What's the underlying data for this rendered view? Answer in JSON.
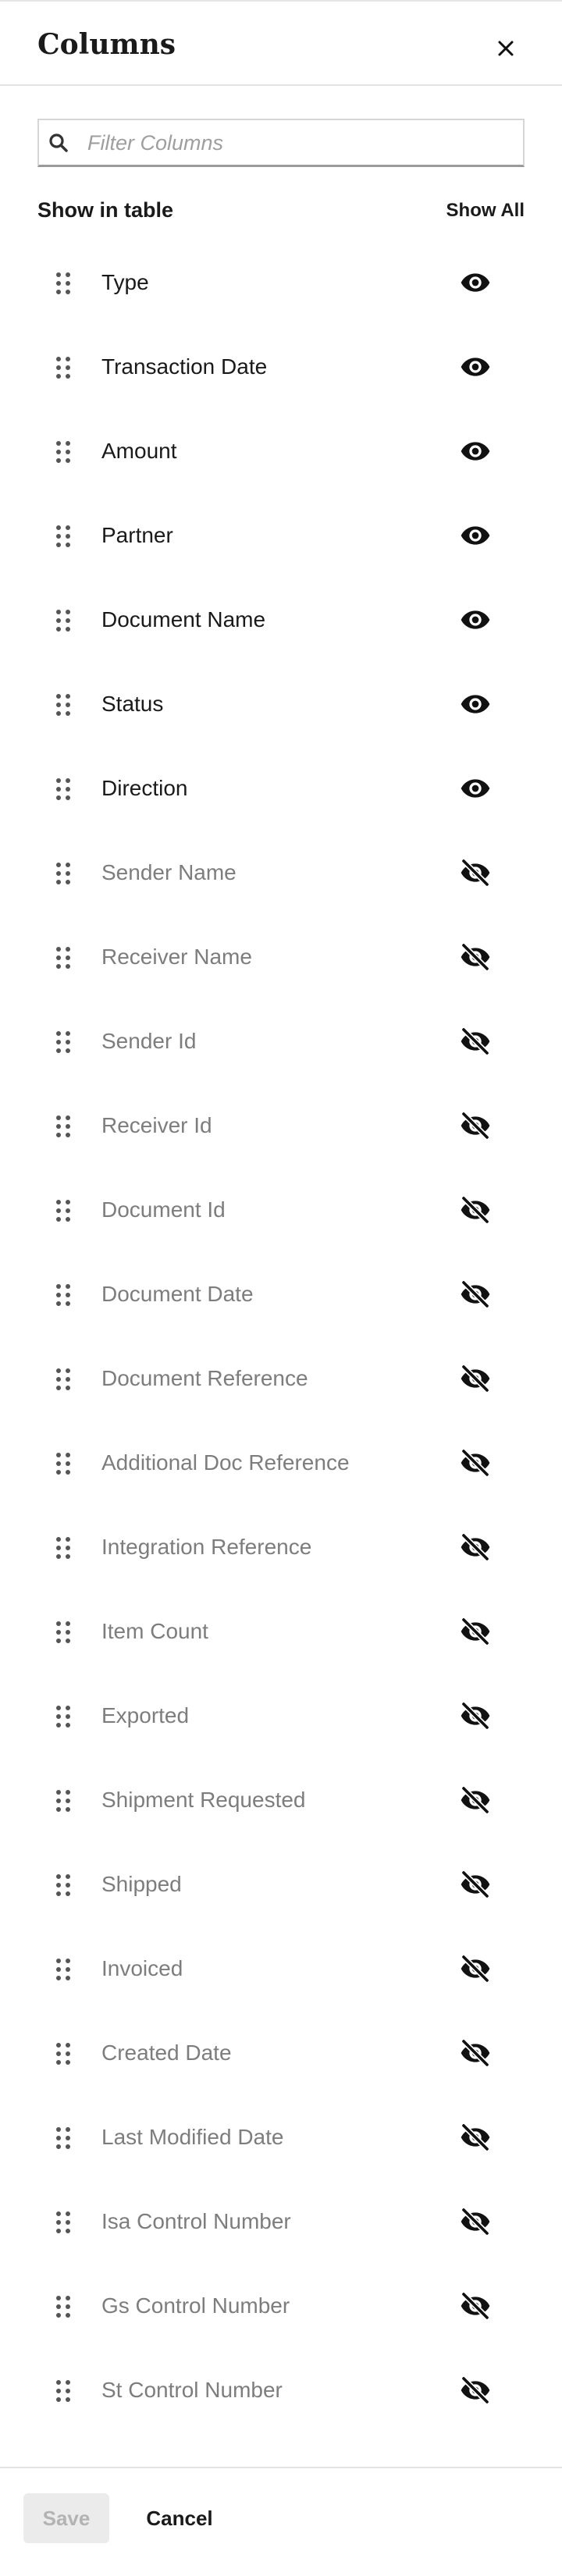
{
  "header": {
    "title": "Columns",
    "close_icon": "close-icon"
  },
  "search": {
    "placeholder": "Filter Columns",
    "value": "",
    "icon": "search-icon"
  },
  "section": {
    "title": "Show in table",
    "show_all_label": "Show All"
  },
  "columns": [
    {
      "label": "Type",
      "visible": true
    },
    {
      "label": "Transaction Date",
      "visible": true
    },
    {
      "label": "Amount",
      "visible": true
    },
    {
      "label": "Partner",
      "visible": true
    },
    {
      "label": "Document Name",
      "visible": true
    },
    {
      "label": "Status",
      "visible": true
    },
    {
      "label": "Direction",
      "visible": true
    },
    {
      "label": "Sender Name",
      "visible": false
    },
    {
      "label": "Receiver Name",
      "visible": false
    },
    {
      "label": "Sender Id",
      "visible": false
    },
    {
      "label": "Receiver Id",
      "visible": false
    },
    {
      "label": "Document Id",
      "visible": false
    },
    {
      "label": "Document Date",
      "visible": false
    },
    {
      "label": "Document Reference",
      "visible": false
    },
    {
      "label": "Additional Doc Reference",
      "visible": false
    },
    {
      "label": "Integration Reference",
      "visible": false
    },
    {
      "label": "Item Count",
      "visible": false
    },
    {
      "label": "Exported",
      "visible": false
    },
    {
      "label": "Shipment Requested",
      "visible": false
    },
    {
      "label": "Shipped",
      "visible": false
    },
    {
      "label": "Invoiced",
      "visible": false
    },
    {
      "label": "Created Date",
      "visible": false
    },
    {
      "label": "Last Modified Date",
      "visible": false
    },
    {
      "label": "Isa Control Number",
      "visible": false
    },
    {
      "label": "Gs Control Number",
      "visible": false
    },
    {
      "label": "St Control Number",
      "visible": false
    }
  ],
  "footer": {
    "save_label": "Save",
    "save_disabled": true,
    "cancel_label": "Cancel"
  },
  "colors": {
    "text": "#1a1a1a",
    "hidden_text": "#7d7d7d",
    "icon": "#111111",
    "drag_icon": "#555555",
    "disabled_bg": "#ebebeb",
    "disabled_text": "#b3b3b3"
  }
}
